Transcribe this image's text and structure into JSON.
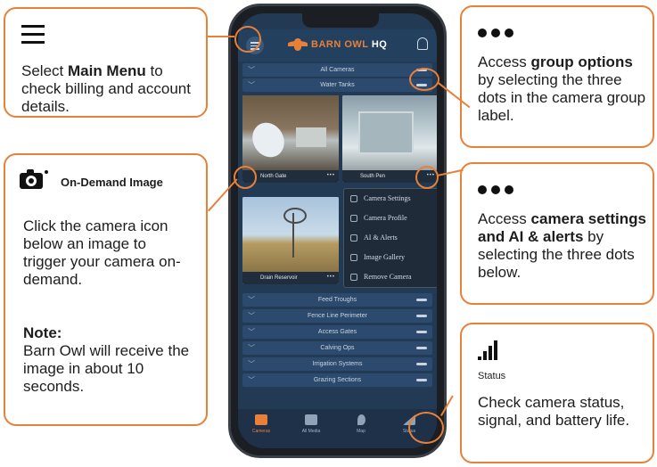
{
  "callouts": {
    "main_menu": {
      "text_before": "Select ",
      "bold": "Main Menu",
      "text_after": " to check billing and account details."
    },
    "on_demand": {
      "title": "On-Demand Image",
      "body": "Click the camera icon below an image to trigger your camera on-demand.",
      "note_label": "Note:",
      "note_body": "Barn Owl will receive the image in about 10 seconds."
    },
    "group_options": {
      "text_before": "Access ",
      "bold": "group options",
      "text_after": " by selecting the three dots in the camera group label."
    },
    "camera_settings": {
      "text_before": "Access ",
      "bold": "camera settings and AI & alerts",
      "text_after": " by selecting the three dots below."
    },
    "status": {
      "label": "Status",
      "body": "Check camera status, signal, and battery life."
    }
  },
  "phone": {
    "logo": {
      "brand": "BARN OWL",
      "suffix": "HQ"
    },
    "groups_top": [
      "All Cameras",
      "Water Tanks"
    ],
    "tiles": [
      {
        "caption": "North Gate"
      },
      {
        "caption": "South Pen"
      },
      {
        "caption": "Drain Reservoir"
      }
    ],
    "camera_menu": [
      "Camera Settings",
      "Camera Profile",
      "AI & Alerts",
      "Image Gallery",
      "Remove Camera"
    ],
    "groups_bottom": [
      "Feed Troughs",
      "Fence Line Perimeter",
      "Access Gates",
      "Calving Ops",
      "Irrigation Systems",
      "Grazing Sections"
    ],
    "nav": [
      "Cameras",
      "All Media",
      "Map",
      "Status"
    ]
  },
  "colors": {
    "accent": "#e8803a",
    "screen_bg": "#233a55"
  },
  "icons": [
    "hamburger-menu-icon",
    "camera-icon",
    "three-dots-icon",
    "signal-bars-icon"
  ]
}
